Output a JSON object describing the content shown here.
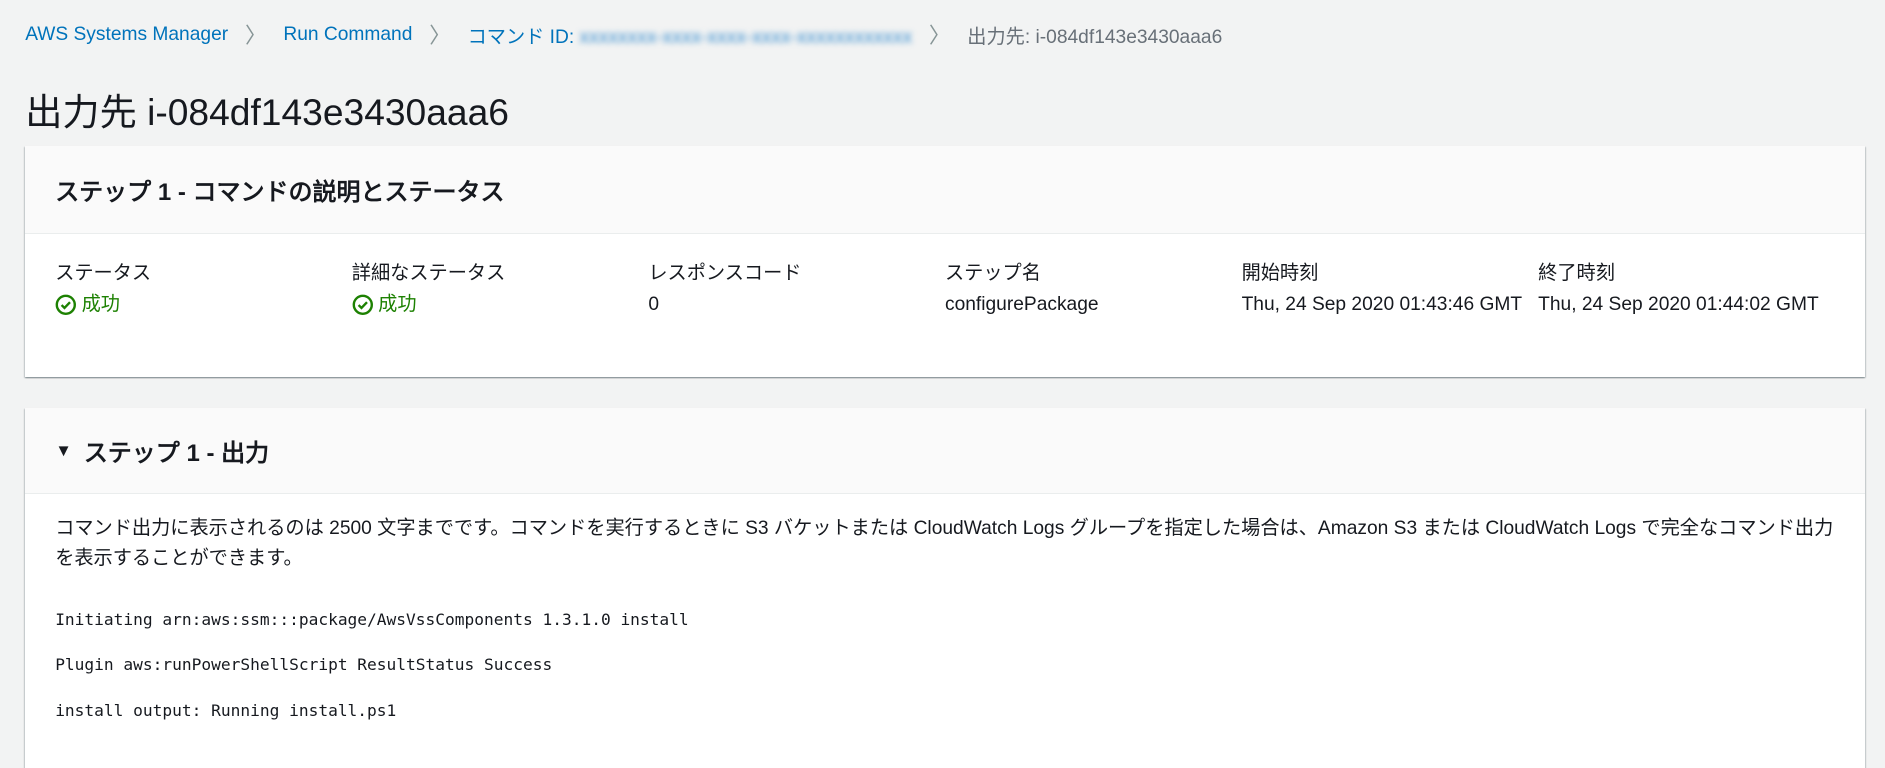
{
  "breadcrumb": {
    "items": [
      "AWS Systems Manager",
      "Run Command",
      "コマンド ID: "
    ],
    "command_id_redacted": "xxxxxxxx-xxxx-xxxx-xxxx-xxxxxxxxxxxx",
    "current": "出力先: i-084df143e3430aaa6"
  },
  "page_title": "出力先 i-084df143e3430aaa6",
  "status_panel": {
    "title": "ステップ 1 - コマンドの説明とステータス",
    "columns": [
      {
        "label": "ステータス",
        "value": "成功",
        "success": true
      },
      {
        "label": "詳細なステータス",
        "value": "成功",
        "success": true
      },
      {
        "label": "レスポンスコード",
        "value": "0"
      },
      {
        "label": "ステップ名",
        "value": "configurePackage"
      },
      {
        "label": "開始時刻",
        "value": "Thu, 24 Sep 2020 01:43:46 GMT"
      },
      {
        "label": "終了時刻",
        "value": "Thu, 24 Sep 2020 01:44:02 GMT"
      }
    ]
  },
  "output_panel": {
    "title": "ステップ 1 - 出力",
    "description": "コマンド出力に表示されるのは 2500 文字までです。コマンドを実行するときに S3 バケットまたは CloudWatch Logs グループを指定した場合は、Amazon S3 または CloudWatch Logs で完全なコマンド出力を表示することができます。",
    "lines": [
      "Initiating arn:aws:ssm:::package/AwsVssComponents 1.3.1.0 install",
      "Plugin aws:runPowerShellScript ResultStatus Success",
      "install output: Running install.ps1"
    ]
  },
  "colors": {
    "link": "#0073bb",
    "success": "#1d8102",
    "background": "#f2f3f3"
  }
}
